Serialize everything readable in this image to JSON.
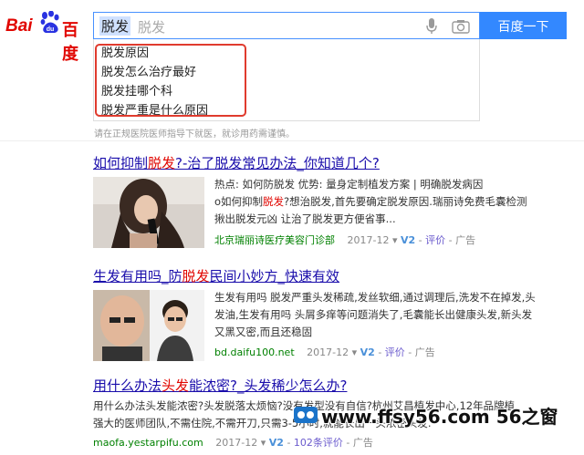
{
  "logo": {
    "left_text": "Bai",
    "right_text": "百度",
    "paw_text": "du"
  },
  "search": {
    "query": "脱发",
    "ghost_text": "脱发",
    "button_label": "百度一下"
  },
  "suggestions": [
    "脱发原因",
    "脱发怎么治疗最好",
    "脱发挂哪个科",
    "脱发严重是什么原因"
  ],
  "notice": "请在正规医院医师指导下就医，就诊用药需谨慎。",
  "results": [
    {
      "title_pre": "如何抑制",
      "title_hl": "脱发",
      "title_post": "?-治了脱发常见办法_你知道几个?",
      "line1": "热点: 如何防脱发   优势: 量身定制植发方案 | 明确脱发病因",
      "line2_pre": "o如何抑制",
      "line2_hl": "脱发",
      "line2_post": "?想治脱发,首先要确定脱发原因.瑞丽诗免费毛囊检测",
      "line3": "揪出脱发元凶 让治了脱发更方便省事...",
      "url": "北京瑞丽诗医疗美容门诊部",
      "date": "2017-12",
      "v": "V2",
      "review": "评价",
      "ad": "广告"
    },
    {
      "title_pre": "生发有用吗_防",
      "title_hl": "脱发",
      "title_post": "民间小妙方_快速有效",
      "line1": "生发有用吗 脱发严重头发稀疏,发丝软细,通过调理后,洗发不在掉发,头",
      "line2": "发油,生发有用吗 头屑多痒等问题消失了,毛囊能长出健康头发,新头发",
      "line3": "又黑又密,而且还稳固",
      "url": "bd.daifu100.net",
      "date": "2017-12",
      "v": "V2",
      "review": "评价",
      "ad": "广告"
    },
    {
      "title_pre": "用什么办法",
      "title_hl": "头发",
      "title_post": "能浓密?_头发稀少怎么办?",
      "line1": "用什么办法头发能浓密?头发脱落太烦恼?没有发型没有自信?杭州艾昌植发中心,12年品牌植",
      "line2": "强大的医师团队,不需住院,不需开刀,只需3-5小时,就能长出一头浓密头发.",
      "url": "maofa.yestarpifu.com",
      "date": "2017-12",
      "v": "V2",
      "review": "102条评价",
      "ad": "广告"
    }
  ],
  "watermark": "www.ffsy56.com 56之窗",
  "colors": {
    "accent": "#3388ff",
    "highlight": "#e10601",
    "link": "#1a0dab",
    "url": "#008000",
    "box": "#e03b2e"
  }
}
